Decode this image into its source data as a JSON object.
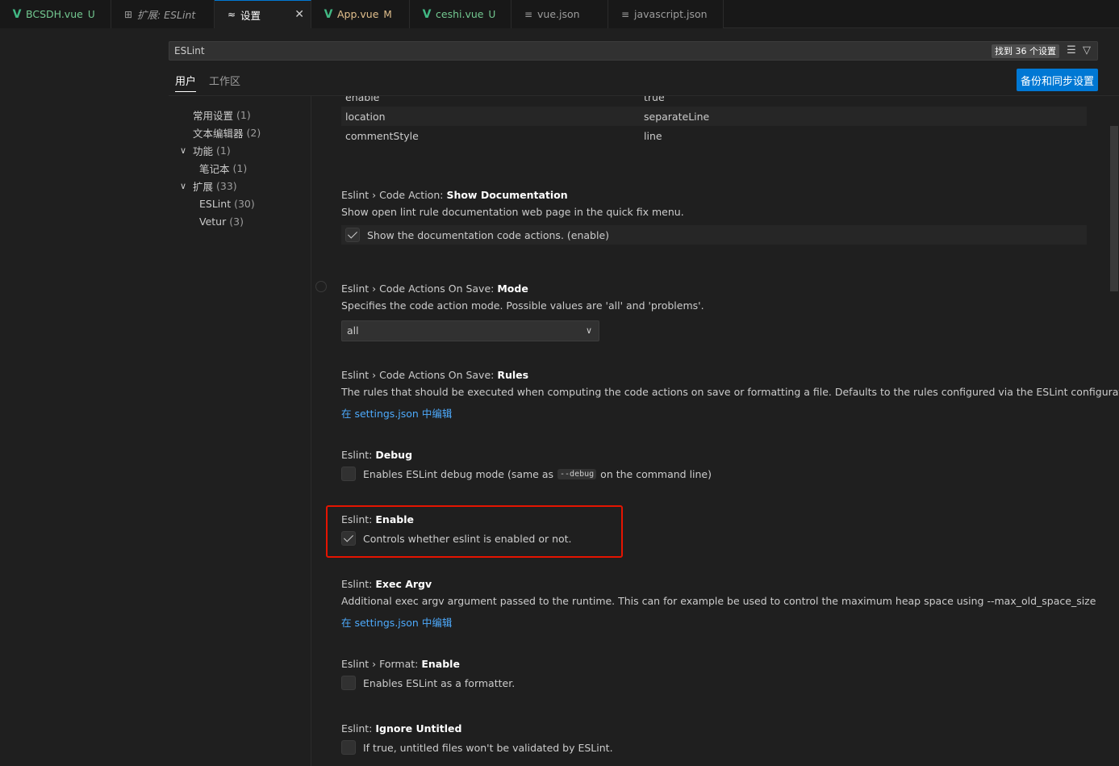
{
  "tabs": [
    {
      "label": "BCSDH.vue",
      "badge": "U",
      "type": "vue",
      "active": false
    },
    {
      "label": "扩展: ESLint",
      "badge": "",
      "type": "extension",
      "active": false
    },
    {
      "label": "设置",
      "badge": "",
      "type": "settings",
      "active": true
    },
    {
      "label": "App.vue",
      "badge": "M",
      "type": "vue",
      "active": false
    },
    {
      "label": "ceshi.vue",
      "badge": "U",
      "type": "vue",
      "active": false
    },
    {
      "label": "vue.json",
      "badge": "",
      "type": "json",
      "active": false
    },
    {
      "label": "javascript.json",
      "badge": "",
      "type": "json",
      "active": false
    }
  ],
  "search": {
    "value": "ESLint",
    "result_count": "找到 36 个设置"
  },
  "scope_tabs": {
    "user": "用户",
    "workspace": "工作区"
  },
  "sync_button": "备份和同步设置",
  "toc": [
    {
      "label": "常用设置",
      "count": "(1)",
      "level": 1,
      "chevron": false
    },
    {
      "label": "文本编辑器",
      "count": "(2)",
      "level": 1,
      "chevron": false
    },
    {
      "label": "功能",
      "count": "(1)",
      "level": 1,
      "chevron": true
    },
    {
      "label": "笔记本",
      "count": "(1)",
      "level": 2,
      "chevron": false
    },
    {
      "label": "扩展",
      "count": "(33)",
      "level": 1,
      "chevron": true
    },
    {
      "label": "ESLint",
      "count": "(30)",
      "level": 2,
      "chevron": false
    },
    {
      "label": "Vetur",
      "count": "(3)",
      "level": 2,
      "chevron": false
    }
  ],
  "object_table": [
    {
      "key": "enable",
      "value": "true"
    },
    {
      "key": "location",
      "value": "separateLine"
    },
    {
      "key": "commentStyle",
      "value": "line"
    }
  ],
  "settings": {
    "show_doc": {
      "category": "Eslint › Code Action: ",
      "name": "Show Documentation",
      "description": "Show open lint rule documentation web page in the quick fix menu.",
      "checkbox_label": "Show the documentation code actions. (enable)",
      "checked": true
    },
    "on_save_mode": {
      "category": "Eslint › Code Actions On Save: ",
      "name": "Mode",
      "description": "Specifies the code action mode. Possible values are 'all' and 'problems'.",
      "selected": "all"
    },
    "on_save_rules": {
      "category": "Eslint › Code Actions On Save: ",
      "name": "Rules",
      "description": "The rules that should be executed when computing the code actions on save or formatting a file. Defaults to the rules configured via the ESLint configuration",
      "link": "在 settings.json 中编辑"
    },
    "debug": {
      "category": "Eslint: ",
      "name": "Debug",
      "desc_before": "Enables ESLint debug mode (same as",
      "code": "--debug",
      "desc_after": "on the command line)",
      "checked": false
    },
    "enable": {
      "category": "Eslint: ",
      "name": "Enable",
      "checkbox_label": "Controls whether eslint is enabled or not.",
      "checked": true
    },
    "exec_argv": {
      "category": "Eslint: ",
      "name": "Exec Argv",
      "description": "Additional exec argv argument passed to the runtime. This can for example be used to control the maximum heap space using --max_old_space_size",
      "link": "在 settings.json 中编辑"
    },
    "format_enable": {
      "category": "Eslint › Format: ",
      "name": "Enable",
      "checkbox_label": "Enables ESLint as a formatter.",
      "checked": false
    },
    "ignore_untitled": {
      "category": "Eslint: ",
      "name": "Ignore Untitled",
      "checkbox_label": "If true, untitled files won't be validated by ESLint.",
      "checked": false
    }
  },
  "colors": {
    "accent": "#0078d4",
    "highlight_border": "#e51400",
    "link": "#4daafc",
    "vue_green": "#41b883"
  }
}
